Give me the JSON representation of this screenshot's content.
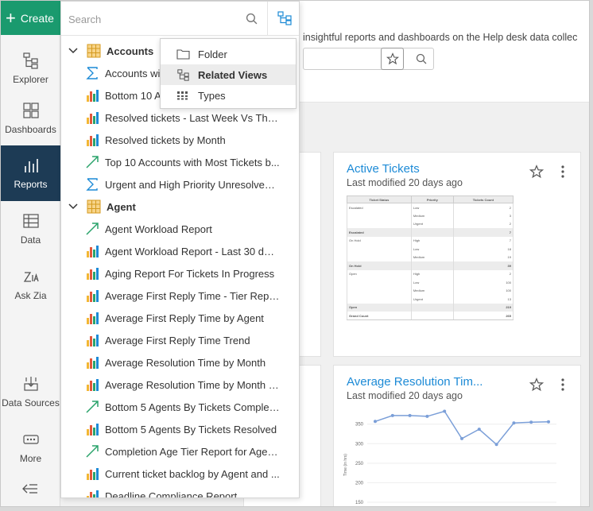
{
  "nav": {
    "create_label": "Create",
    "items": [
      {
        "label": "Explorer",
        "icon": "explorer-icon"
      },
      {
        "label": "Dashboards",
        "icon": "dashboards-icon"
      },
      {
        "label": "Reports",
        "icon": "reports-icon",
        "active": true
      },
      {
        "label": "Data",
        "icon": "data-icon"
      },
      {
        "label": "Ask Zia",
        "icon": "ask-zia-icon"
      },
      {
        "label": "Data Sources",
        "icon": "data-sources-icon"
      },
      {
        "label": "More",
        "icon": "more-icon"
      }
    ]
  },
  "main": {
    "description": "insightful reports and dashboards on the Help desk data collec"
  },
  "cards": [
    {
      "title": "Active Tickets",
      "subtitle": "Last modified 20 days ago",
      "table": {
        "headers": [
          "Ticket Status",
          "Priority",
          "Tickets Count"
        ],
        "rows": [
          {
            "status": "Escalated",
            "priority": "Low",
            "count": "2"
          },
          {
            "status": "",
            "priority": "Medium",
            "count": "3"
          },
          {
            "status": "",
            "priority": "Urgent",
            "count": "2"
          },
          {
            "status": "Escalated",
            "priority": "",
            "count": "7",
            "subtotal": true
          },
          {
            "status": "On Hold",
            "priority": "High",
            "count": "7"
          },
          {
            "status": "",
            "priority": "Low",
            "count": "18"
          },
          {
            "status": "",
            "priority": "Medium",
            "count": "19"
          },
          {
            "status": "On Hold",
            "priority": "",
            "count": "39",
            "subtotal": true
          },
          {
            "status": "Open",
            "priority": "High",
            "count": "2"
          },
          {
            "status": "",
            "priority": "Low",
            "count": "100"
          },
          {
            "status": "",
            "priority": "Medium",
            "count": "100"
          },
          {
            "status": "",
            "priority": "Urgent",
            "count": "13"
          },
          {
            "status": "Open",
            "priority": "",
            "count": "219",
            "subtotal": true
          },
          {
            "status": "Grand Count",
            "priority": "",
            "count": "265",
            "grand": true
          }
        ]
      }
    },
    {
      "title": "Average Resolution Tim...",
      "subtitle": "Last modified 20 days ago",
      "chart_data": {
        "type": "line",
        "ylabel": "Time (in hrs)",
        "y_ticks": [
          150,
          200,
          250,
          300,
          350
        ],
        "ylim": [
          150,
          380
        ],
        "values": [
          357,
          372,
          372,
          370,
          383,
          313,
          337,
          298,
          353,
          355,
          356
        ],
        "color": "#7b9fd8"
      }
    }
  ],
  "panel": {
    "search_placeholder": "Search",
    "groups": [
      {
        "name": "Accounts",
        "items": [
          {
            "label": "Accounts with...",
            "type": "summary"
          },
          {
            "label": "Bottom 10 A...",
            "type": "bar"
          },
          {
            "label": "Resolved tickets - Last Week Vs This ...",
            "type": "bar"
          },
          {
            "label": "Resolved tickets by Month",
            "type": "bar"
          },
          {
            "label": "Top 10 Accounts with Most Tickets b...",
            "type": "trend"
          },
          {
            "label": "Urgent and High Priority Unresolved ...",
            "type": "summary"
          }
        ]
      },
      {
        "name": "Agent",
        "items": [
          {
            "label": "Agent Workload Report",
            "type": "trend"
          },
          {
            "label": "Agent Workload Report - Last 30 days",
            "type": "bar"
          },
          {
            "label": "Aging Report For Tickets In Progress",
            "type": "bar"
          },
          {
            "label": "Average First Reply Time - Tier Report",
            "type": "bar"
          },
          {
            "label": "Average First Reply Time by Agent",
            "type": "bar"
          },
          {
            "label": "Average First Reply Time Trend",
            "type": "bar"
          },
          {
            "label": "Average Resolution Time by Month",
            "type": "bar"
          },
          {
            "label": "Average Resolution Time by Month a...",
            "type": "bar"
          },
          {
            "label": "Bottom 5 Agents By Tickets Complet...",
            "type": "trend"
          },
          {
            "label": "Bottom 5 Agents By Tickets Resolved",
            "type": "bar"
          },
          {
            "label": "Completion Age Tier Report for Agen...",
            "type": "trend"
          },
          {
            "label": "Current ticket backlog by Agent and ...",
            "type": "bar"
          },
          {
            "label": "Deadline Compliance Report",
            "type": "bar"
          }
        ]
      }
    ]
  },
  "popover": {
    "items": [
      {
        "label": "Folder",
        "icon": "folder-icon"
      },
      {
        "label": "Related Views",
        "icon": "related-views-icon",
        "selected": true
      },
      {
        "label": "Types",
        "icon": "types-icon"
      }
    ]
  },
  "colors": {
    "create": "#1a9a6e",
    "nav_active": "#1d3b55",
    "link": "#1c8ad6",
    "table_icon": "#e8b23a"
  }
}
